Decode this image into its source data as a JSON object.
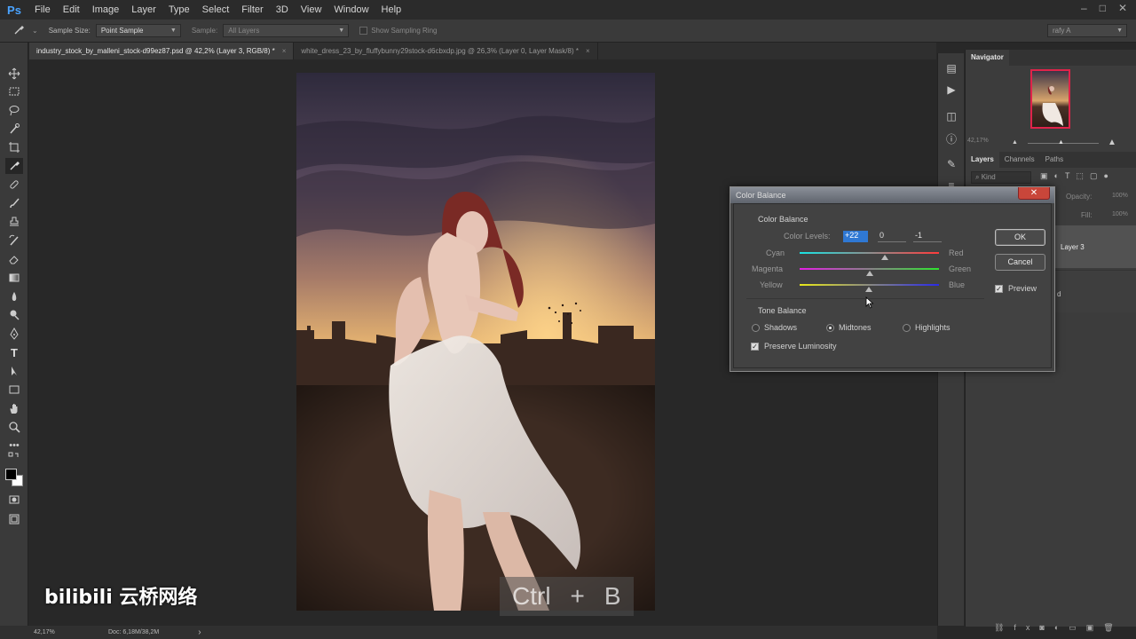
{
  "app": {
    "logo": "Ps"
  },
  "menu": [
    "File",
    "Edit",
    "Image",
    "Layer",
    "Type",
    "Select",
    "Filter",
    "3D",
    "View",
    "Window",
    "Help"
  ],
  "window_controls": [
    "–",
    "□",
    "✕"
  ],
  "options": {
    "sample_size_label": "Sample Size:",
    "sample_size_value": "Point Sample",
    "sample_label": "Sample:",
    "sample_value": "All Layers",
    "sampling_ring_label": "Show Sampling Ring",
    "workspace_value": "rafy A"
  },
  "tabs": [
    {
      "label": "industry_stock_by_malleni_stock-d99ez87.psd @ 42,2% (Layer 3, RGB/8) *",
      "close": "×"
    },
    {
      "label": "white_dress_23_by_fluffybunny29stock-d6cbxdp.jpg @ 26,3% (Layer 0, Layer Mask/8) *",
      "close": "×"
    }
  ],
  "navigator": {
    "title": "Navigator",
    "zoom": "42,17%"
  },
  "layers_panel": {
    "tabs": [
      "Layers",
      "Channels",
      "Paths"
    ],
    "kind_label": "Kind",
    "opacity_label": "Opacity:",
    "opacity_value": "100%",
    "fill_label": "Fill:",
    "fill_value": "100%",
    "layer_name": "Layer 3",
    "partial_text": "d"
  },
  "status": {
    "zoom": "42,17%",
    "doc": "Doc: 6,18M/38,2M",
    "arrow": "›"
  },
  "dialog": {
    "title": "Color Balance",
    "close": "✕",
    "color_balance_label": "Color Balance",
    "levels_label": "Color Levels:",
    "levels": [
      "+22",
      "0",
      "-1"
    ],
    "sliders": [
      {
        "left": "Cyan",
        "right": "Red",
        "value": 22
      },
      {
        "left": "Magenta",
        "right": "Green",
        "value": 0
      },
      {
        "left": "Yellow",
        "right": "Blue",
        "value": -1
      }
    ],
    "tone_label": "Tone Balance",
    "tones": [
      "Shadows",
      "Midtones",
      "Highlights"
    ],
    "tone_selected": "Midtones",
    "preserve_label": "Preserve Luminosity",
    "preserve_checked": true,
    "ok": "OK",
    "cancel": "Cancel",
    "preview_label": "Preview",
    "preview_checked": true
  },
  "overlay": {
    "watermark": "bilibili 云桥网络",
    "keys": [
      "Ctrl",
      "+",
      "B"
    ]
  }
}
